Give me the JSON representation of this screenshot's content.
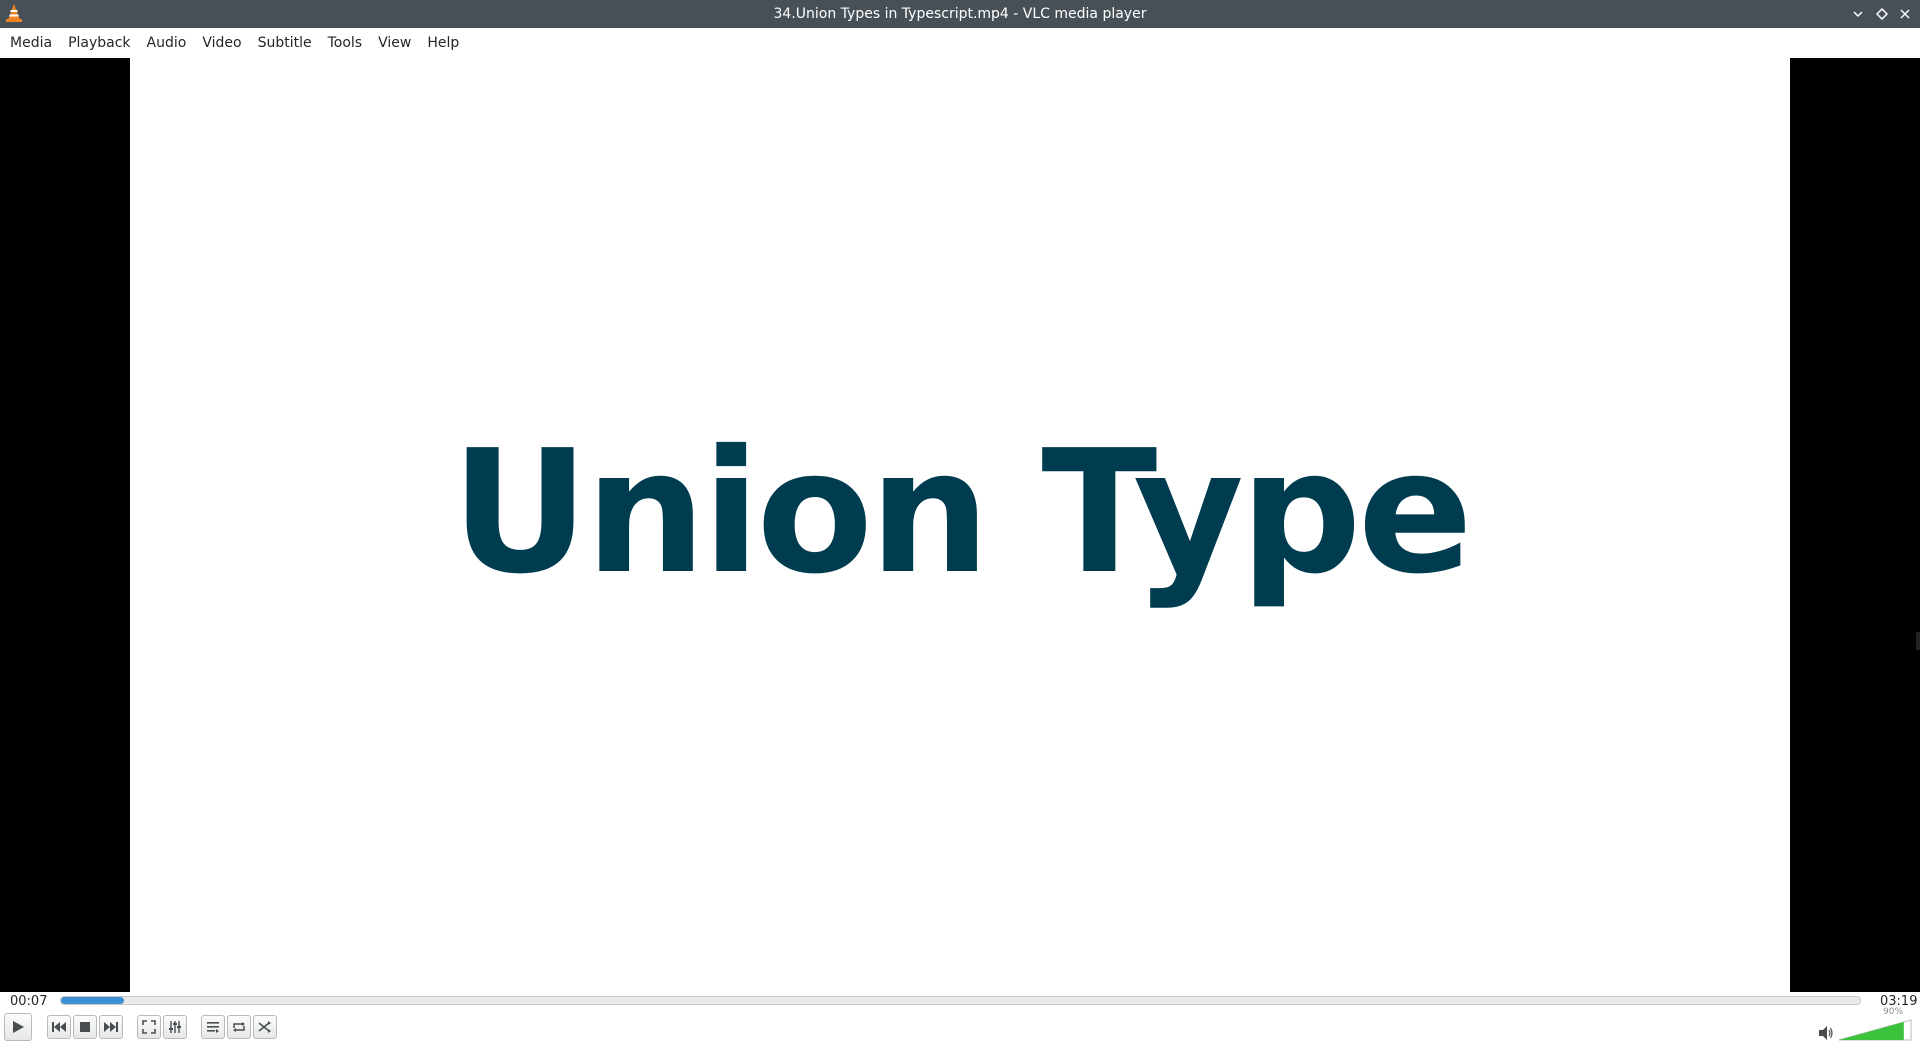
{
  "window": {
    "title": "34.Union Types in Typescript.mp4 - VLC media player"
  },
  "menu": [
    "Media",
    "Playback",
    "Audio",
    "Video",
    "Subtitle",
    "Tools",
    "View",
    "Help"
  ],
  "video": {
    "frame_text": "Union Type",
    "text_color": "#003c4f"
  },
  "playback": {
    "elapsed": "00:07",
    "total": "03:19",
    "progress_fraction": 0.035
  },
  "volume": {
    "label": "90%",
    "level_fraction": 0.9
  },
  "colors": {
    "titlebar": "#475057",
    "seek_fill": "#3d8fd6",
    "volume_fill": "#3cc23c"
  },
  "icons": [
    "vlc-cone-icon",
    "minimize-icon",
    "maximize-icon",
    "close-icon",
    "play-icon",
    "previous-icon",
    "stop-icon",
    "next-icon",
    "fullscreen-icon",
    "extended-settings-icon",
    "playlist-icon",
    "loop-icon",
    "shuffle-icon",
    "speaker-icon"
  ]
}
